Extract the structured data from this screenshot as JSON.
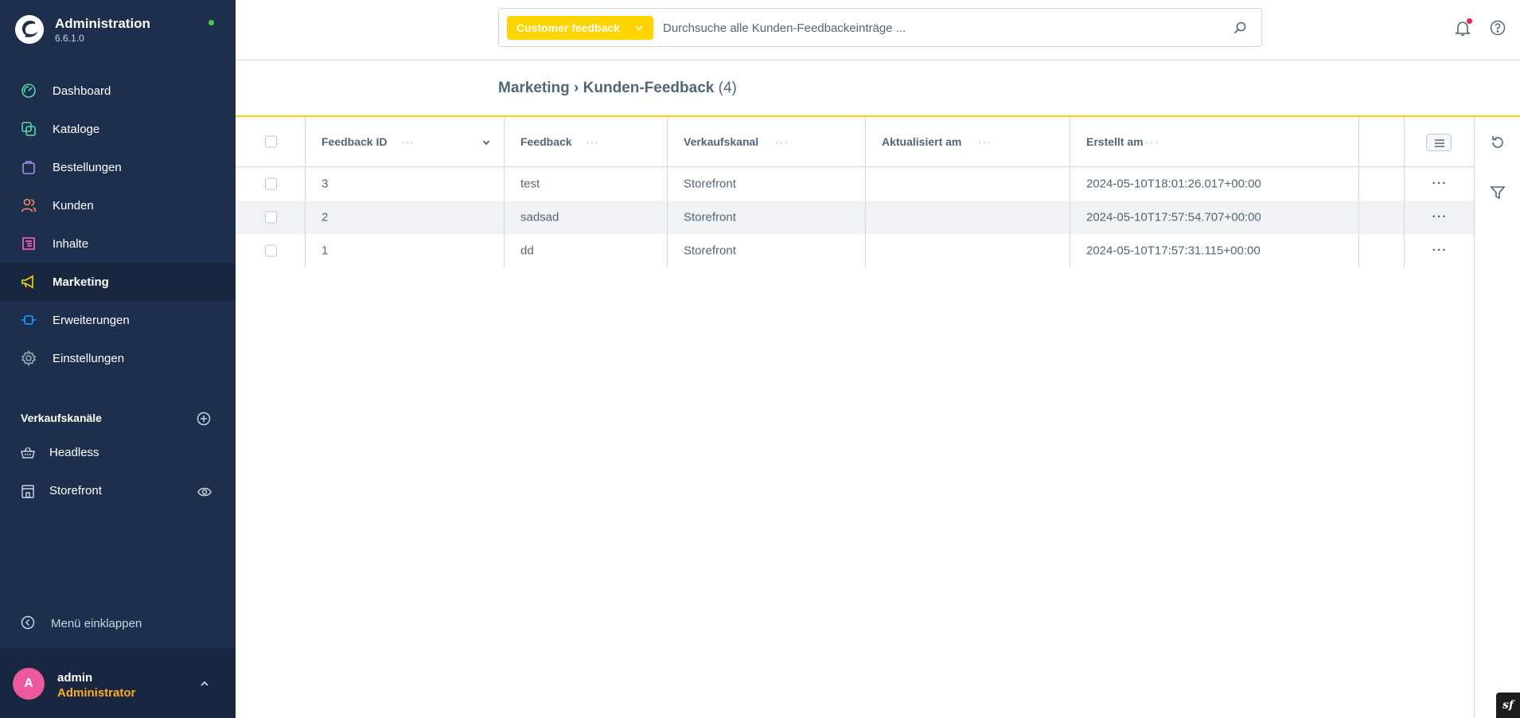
{
  "app": {
    "title": "Administration",
    "version": "6.6.1.0",
    "status_color": "#37d046"
  },
  "sidebar": {
    "items": [
      {
        "label": "Dashboard",
        "icon": "gauge-icon",
        "color": "#57d9a3"
      },
      {
        "label": "Kataloge",
        "icon": "layers-icon",
        "color": "#57d9a3"
      },
      {
        "label": "Bestellungen",
        "icon": "shopping-bag-icon",
        "color": "#a092f0"
      },
      {
        "label": "Kunden",
        "icon": "users-icon",
        "color": "#f88962"
      },
      {
        "label": "Inhalte",
        "icon": "content-list-icon",
        "color": "#ff68b4"
      },
      {
        "label": "Marketing",
        "icon": "megaphone-icon",
        "color": "#ffd700",
        "active": true
      },
      {
        "label": "Erweiterungen",
        "icon": "plug-icon",
        "color": "#189eff"
      },
      {
        "label": "Einstellungen",
        "icon": "gear-icon",
        "color": "#9aa8b5"
      }
    ],
    "sales_channels_title": "Verkaufskanäle",
    "sales_channels": [
      {
        "label": "Headless",
        "icon": "basket-icon"
      },
      {
        "label": "Storefront",
        "icon": "storefront-icon"
      }
    ],
    "collapse_label": "Menü einklappen",
    "user": {
      "initial": "A",
      "name": "admin",
      "role": "Administrator",
      "avatar_color": "#ec5a9d"
    }
  },
  "topbar": {
    "search_type": "Customer feedback",
    "search_placeholder": "Durchsuche alle Kunden-Feedbackeinträge ...",
    "accent": "#ffd500"
  },
  "breadcrumb": {
    "section": "Marketing",
    "separator": "›",
    "page": "Kunden-Feedback",
    "count": "(4)"
  },
  "grid": {
    "columns": [
      "Feedback ID",
      "Feedback",
      "Verkaufskanal",
      "Aktualisiert am",
      "Erstellt am"
    ],
    "rows": [
      {
        "id": "3",
        "feedback": "test",
        "channel": "Storefront",
        "updated": "",
        "created": "2024-05-10T18:01:26.017+00:00"
      },
      {
        "id": "2",
        "feedback": "sadsad",
        "channel": "Storefront",
        "updated": "",
        "created": "2024-05-10T17:57:54.707+00:00"
      },
      {
        "id": "1",
        "feedback": "dd",
        "channel": "Storefront",
        "updated": "",
        "created": "2024-05-10T17:57:31.115+00:00"
      }
    ],
    "row_action": "···",
    "header_dots": "···"
  },
  "badge": {
    "text": "sf"
  }
}
